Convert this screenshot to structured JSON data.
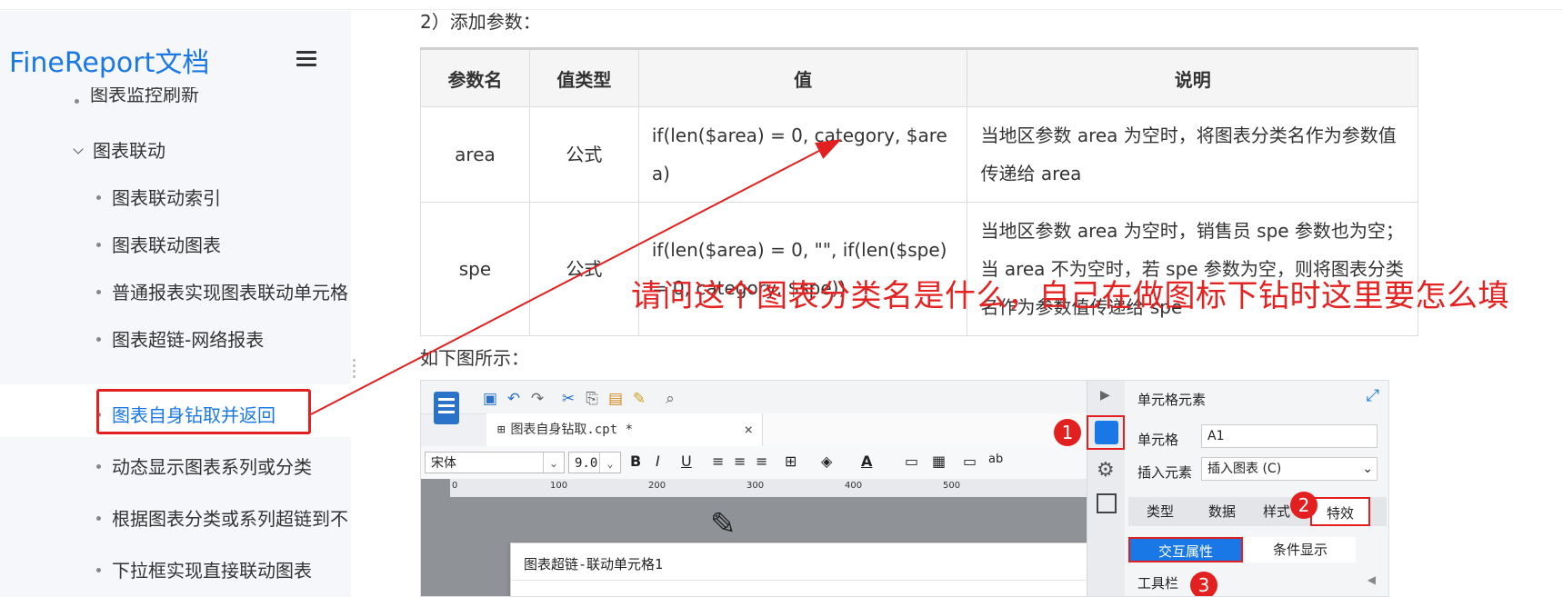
{
  "sidebar": {
    "brand": "FineReport文档",
    "items": [
      {
        "label": "图表监控刷新",
        "level": 1
      },
      {
        "label": "图表联动",
        "level": 0
      },
      {
        "label": "图表联动索引",
        "level": 1
      },
      {
        "label": "图表联动图表",
        "level": 1
      },
      {
        "label": "普通报表实现图表联动单元格",
        "level": 1
      },
      {
        "label": "图表超链-网络报表",
        "level": 1
      },
      {
        "label": "图表自身钻取并返回",
        "level": 1,
        "selected": true
      },
      {
        "label": "动态显示图表系列或分类",
        "level": 1
      },
      {
        "label": "根据图表分类或系列超链到不",
        "level": 1
      },
      {
        "label": "下拉框实现直接联动图表",
        "level": 1
      }
    ]
  },
  "content": {
    "heading": "2）添加参数：",
    "table": {
      "headers": [
        "参数名",
        "值类型",
        "值",
        "说明"
      ],
      "rows": [
        [
          "area",
          "公式",
          "if(len($area) = 0, category, $area)",
          "当地区参数 area 为空时，将图表分类名作为参数值传递给 area"
        ],
        [
          "spe",
          "公式",
          "if(len($area) = 0, \"\", if(len($spe) = 0, category, $spe))",
          "当地区参数 area 为空时，销售员 spe 参数也为空；当 area 不为空时，若 spe 参数为空，则将图表分类名作为参数值传递给 spe"
        ]
      ]
    },
    "below_text": "如下图所示：",
    "question": "请问这个图表分类名是什么，自己在做图标下钻时这里要怎么填"
  },
  "screenshot": {
    "tab_label": "图表自身钻取.cpt *",
    "font_name": "宋体",
    "font_size": "9.0",
    "ruler_ticks": [
      "0",
      "100",
      "200",
      "300",
      "400",
      "500"
    ],
    "dialog_title": "图表超链-联动单元格1",
    "panel_title": "单元格元素",
    "cell_label": "单元格",
    "cell_value": "A1",
    "insert_label": "插入元素",
    "insert_value": "插入图表",
    "tabs": [
      "类型",
      "数据",
      "样式",
      "特效"
    ],
    "subtabs": [
      "交互属性",
      "条件显示"
    ],
    "toolbar_label": "工具栏",
    "badges": [
      "1",
      "2",
      "3"
    ]
  },
  "colors": {
    "accent": "#1a78e6",
    "annotation": "#e32020",
    "question": "#e52222"
  }
}
